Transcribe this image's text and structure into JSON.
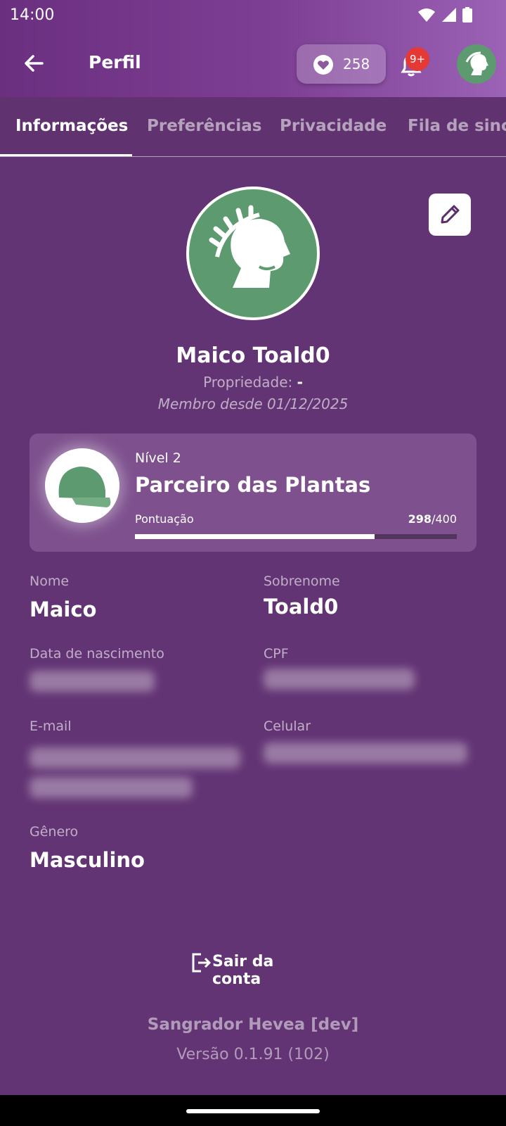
{
  "status_bar": {
    "time": "14:00"
  },
  "app_bar": {
    "title": "Perfil",
    "points": "258",
    "notification_badge": "9+"
  },
  "tabs": [
    {
      "label": "Informações"
    },
    {
      "label": "Preferências"
    },
    {
      "label": "Privacidade"
    },
    {
      "label": "Fila de sincr"
    }
  ],
  "profile": {
    "name": "Maico Toald0",
    "property_label": "Propriedade:",
    "property_value": "-",
    "member_since": "Membro desde 01/12/2025"
  },
  "level": {
    "subtitle": "Nível 2",
    "title": "Parceiro das Plantas",
    "score_label": "Pontuação",
    "score_current": "298",
    "score_max": "/400",
    "progress": 0.745
  },
  "fields": {
    "first_name_label": "Nome",
    "first_name_value": "Maico",
    "last_name_label": "Sobrenome",
    "last_name_value": "Toald0",
    "birth_label": "Data de nascimento",
    "cpf_label": "CPF",
    "email_label": "E-mail",
    "phone_label": "Celular",
    "gender_label": "Gênero",
    "gender_value": "Masculino"
  },
  "logout": {
    "label": "Sair da conta"
  },
  "footer": {
    "app_name": "Sangrador Hevea [dev]",
    "version": "Versão 0.1.91 (102)"
  },
  "colors": {
    "background": "#633474",
    "header_start": "#6b2f80",
    "header_end": "#9b62b6",
    "card": "#7e518e",
    "avatar": "#5d9a6f",
    "badge": "#e53935"
  }
}
